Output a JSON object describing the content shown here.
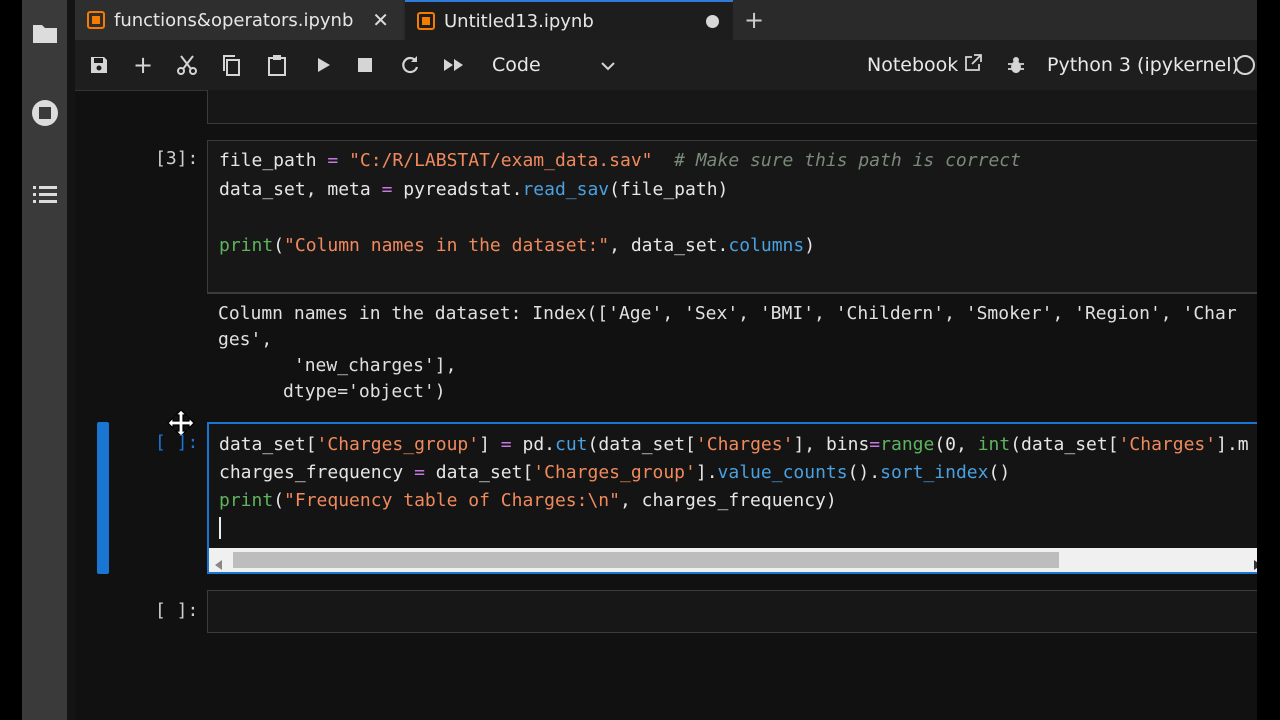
{
  "tabs": [
    {
      "label": "functions&operators.ipynb",
      "icon": "notebook-icon",
      "state": "close"
    },
    {
      "label": "Untitled13.ipynb",
      "icon": "notebook-icon",
      "state": "unsaved"
    }
  ],
  "toolbar": {
    "cell_type": "Code",
    "notebook_label": "Notebook",
    "kernel": "Python 3 (ipykernel)"
  },
  "cells": [
    {
      "prompt": "[3]:",
      "code": {
        "line1_var": "file_path",
        "line1_eq": " = ",
        "line1_str": "\"C:/R/LABSTAT/exam_data.sav\"",
        "line1_comment": "  # Make sure this path is correct",
        "line2_a": "data_set, meta ",
        "line2_eq": "=",
        "line2_b": " pyreadstat.",
        "line2_fn": "read_sav",
        "line2_c": "(file_path)",
        "line4_kw": "print",
        "line4_a": "(",
        "line4_str": "\"Column names in the dataset:\"",
        "line4_b": ", data_set.",
        "line4_attr": "columns",
        "line4_c": ")"
      },
      "output": [
        "Column names in the dataset: Index(['Age', 'Sex', 'BMI', 'Childern', 'Smoker', 'Region', 'Char",
        "ges',",
        "       'new_charges'],",
        "      dtype='object')"
      ]
    },
    {
      "prompt": "[ ]:",
      "code": {
        "l1_a": "data_set[",
        "l1_s1": "'Charges_group'",
        "l1_b": "] ",
        "l1_eq": "=",
        "l1_c": " pd.",
        "l1_fn": "cut",
        "l1_d": "(data_set[",
        "l1_s2": "'Charges'",
        "l1_e": "], bins",
        "l1_eq2": "=",
        "l1_kw": "range",
        "l1_f": "(0, ",
        "l1_kw2": "int",
        "l1_g": "(data_set[",
        "l1_s3": "'Charges'",
        "l1_h": "].m",
        "l2_a": "charges_frequency ",
        "l2_eq": "=",
        "l2_b": " data_set[",
        "l2_s": "'Charges_group'",
        "l2_c": "].",
        "l2_fn1": "value_counts",
        "l2_d": "().",
        "l2_fn2": "sort_index",
        "l2_e": "()",
        "l3_kw": "print",
        "l3_a": "(",
        "l3_str": "\"Frequency table of Charges:\\n\"",
        "l3_b": ", charges_frequency)"
      }
    },
    {
      "prompt": "[ ]:"
    }
  ],
  "colors": {
    "accent": "#1976d2",
    "notebook_icon": "#f57c00",
    "string": "#f08a5d",
    "keyword": "#5fb35f",
    "function": "#4aa0e0"
  }
}
